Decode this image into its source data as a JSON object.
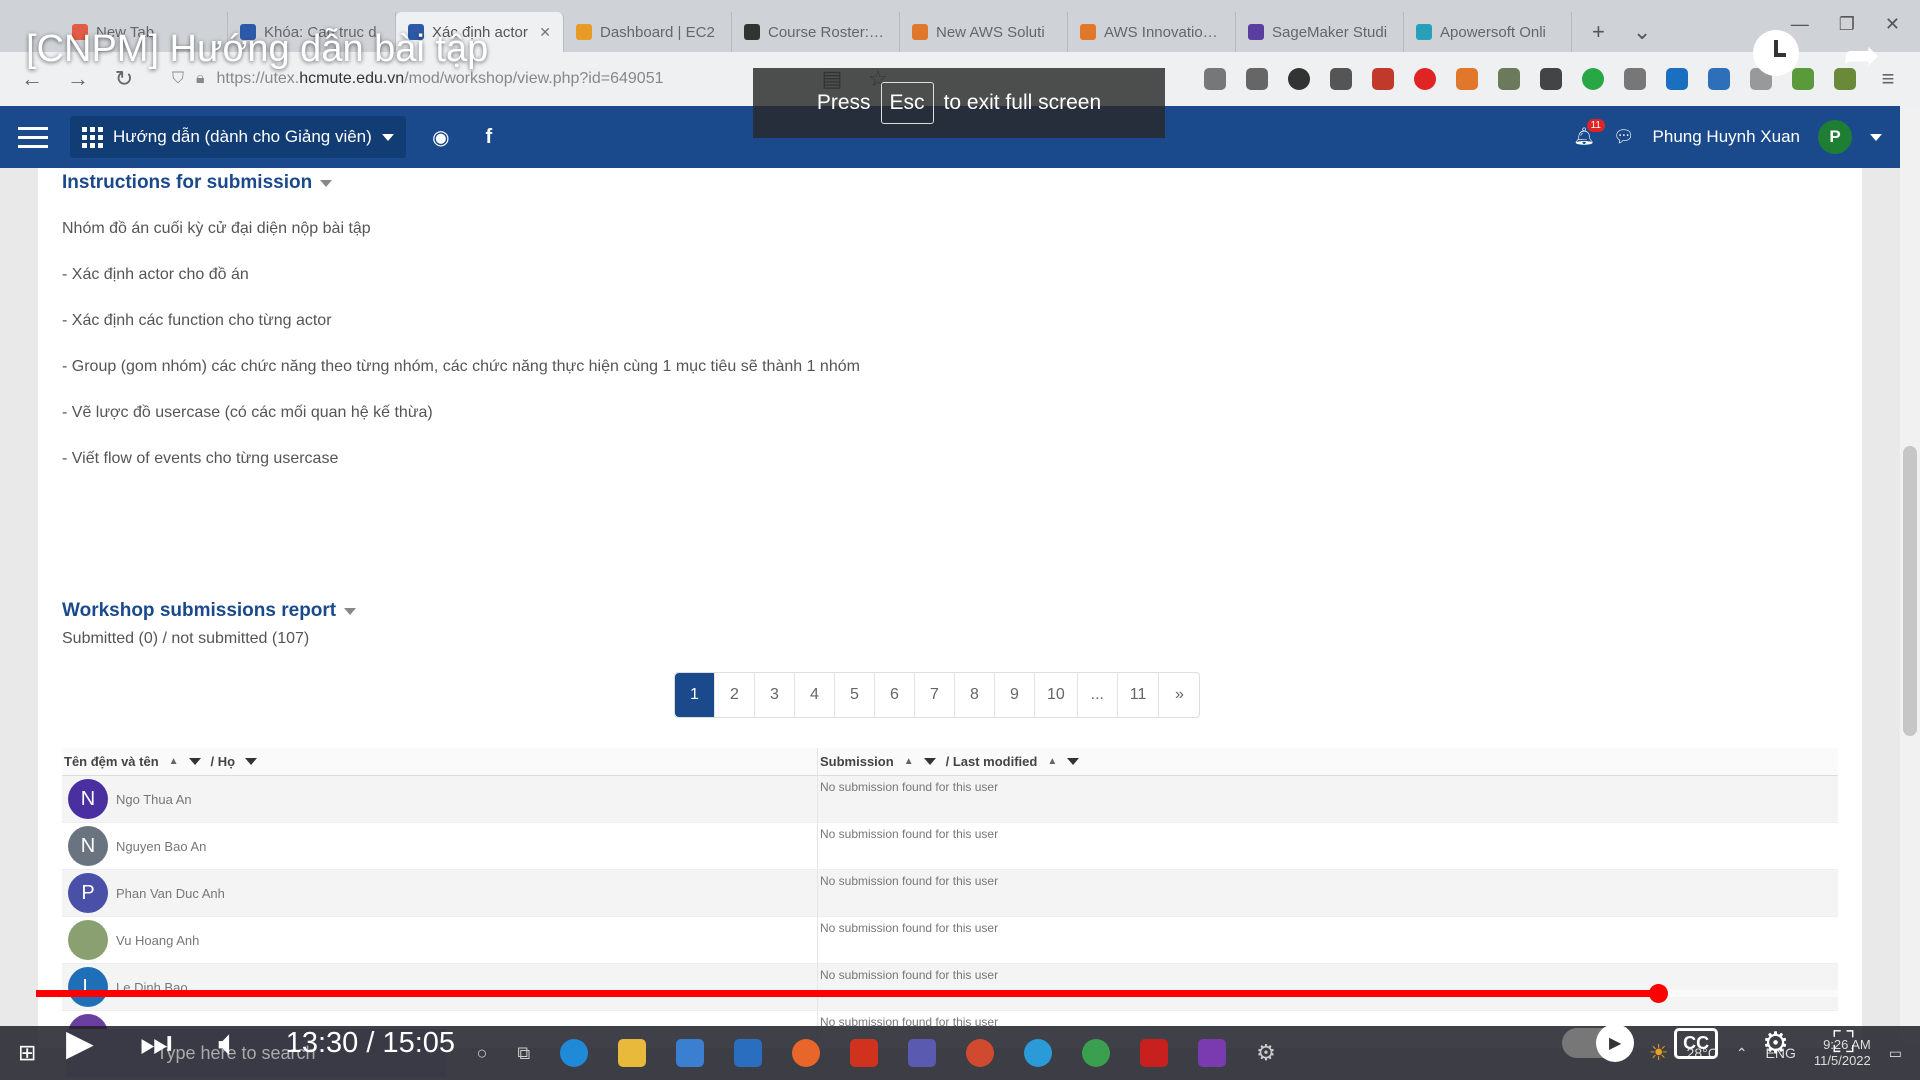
{
  "browser": {
    "tabs": [
      {
        "label": "New Tab",
        "color": "#e25b45"
      },
      {
        "label": "Khóa: Cau truc d",
        "color": "#2d5aa8"
      },
      {
        "label": "Xác định actor",
        "color": "#2d5aa8",
        "active": true
      },
      {
        "label": "Dashboard | EC2",
        "color": "#e89b24"
      },
      {
        "label": "Course Roster: AW",
        "color": "#333333"
      },
      {
        "label": "New AWS Soluti",
        "color": "#e0772a"
      },
      {
        "label": "AWS Innovation S",
        "color": "#e0772a"
      },
      {
        "label": "SageMaker Studi",
        "color": "#5a3fa0"
      },
      {
        "label": "Apowersoft Onli",
        "color": "#2aa0b8"
      }
    ],
    "new_tab_symbol": "+",
    "url_prefix": "https://utex.",
    "url_domain": "hcmute.edu.vn",
    "url_path": "/mod/workshop/view.php?id=649051"
  },
  "fullscreen_notice": {
    "press": "Press",
    "key": "Esc",
    "message": "to exit full screen"
  },
  "navbar": {
    "course_menu_label": "Hướng dẫn (dành cho Giảng viên)",
    "user_name": "Phung Huynh Xuan",
    "user_initial": "P",
    "notification_count": "11"
  },
  "instructions": {
    "title": "Instructions for submission",
    "lines": [
      "Nhóm đồ án cuối kỳ cử đại diện nộp bài tập",
      "- Xác định actor cho đồ án",
      "- Xác định các function cho từng actor",
      "- Group (gom nhóm) các chức năng theo từng nhóm, các chức năng thực hiện cùng 1 mục tiêu sẽ thành 1 nhóm",
      "- Vẽ lược đồ usercase (có các mối quan hệ kế thừa)",
      "- Viết flow of events cho từng usercase"
    ]
  },
  "report": {
    "title": "Workshop submissions report",
    "summary": "Submitted (0) / not submitted (107)",
    "pages": [
      "1",
      "2",
      "3",
      "4",
      "5",
      "6",
      "7",
      "8",
      "9",
      "10",
      "...",
      "11",
      "»"
    ],
    "active_page": "1",
    "columns": {
      "name": "Tên đệm và tên",
      "surname": "/ Họ",
      "submission": "Submission",
      "last_modified": "/ Last modified"
    },
    "rows": [
      {
        "initial": "N",
        "name": "Ngo Thua An",
        "color": "#4a2fa0",
        "status": "No submission found for this user"
      },
      {
        "initial": "N",
        "name": "Nguyen Bao An",
        "color": "#6a7480",
        "status": "No submission found for this user"
      },
      {
        "initial": "P",
        "name": "Phan Van Duc Anh",
        "color": "#4a4fa8",
        "status": "No submission found for this user"
      },
      {
        "initial": "",
        "name": "Vu Hoang Anh",
        "color": "#8aa070",
        "status": "No submission found for this user"
      },
      {
        "initial": "L",
        "name": "Le Dinh Bao",
        "color": "#1f6fb8",
        "status": "No submission found for this user"
      },
      {
        "initial": "",
        "name": "",
        "color": "#6a3fa0",
        "status": "No submission found for this user"
      }
    ]
  },
  "video": {
    "title": "[CNPM] Hướng dẫn bài tập",
    "current_time": "13:30",
    "duration": "15:05",
    "progress_fraction": 0.894
  },
  "taskbar": {
    "search_placeholder": "Type here to search",
    "temperature": "28°C",
    "language": "ENG",
    "clock_time": "9:26 AM",
    "clock_date": "11/5/2022"
  }
}
